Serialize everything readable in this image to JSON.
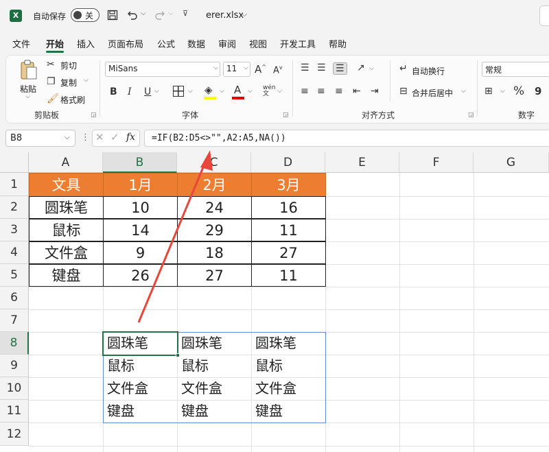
{
  "titlebar": {
    "autosave_label": "自动保存",
    "autosave_state": "关",
    "filename": "erer.xlsx",
    "chevron": "⌵"
  },
  "menu": [
    "文件",
    "开始",
    "插入",
    "页面布局",
    "公式",
    "数据",
    "审阅",
    "视图",
    "开发工具",
    "帮助"
  ],
  "ribbon": {
    "paste": "粘贴",
    "cut": "剪切",
    "copy": "复制",
    "format_painter": "格式刷",
    "clipboard_group": "剪贴板",
    "font_name": "MiSans",
    "font_size": "11",
    "bold": "B",
    "italic": "I",
    "underline": "U",
    "font_group": "字体",
    "wrap_text": "自动换行",
    "merge_center": "合并后居中",
    "alignment_group": "对齐方式",
    "number_format": "常规",
    "number_group": "数字",
    "percent": "%",
    "comma": "9"
  },
  "formula_bar": {
    "name_box": "B8",
    "formula": "=IF(B2:D5<>\"\",A2:A5,NA())",
    "fx": "fx"
  },
  "columns": [
    "A",
    "B",
    "C",
    "D",
    "E",
    "F",
    "G"
  ],
  "rows": [
    "1",
    "2",
    "3",
    "4",
    "5",
    "6",
    "7",
    "8",
    "9",
    "10",
    "11",
    "12"
  ],
  "table": {
    "header": [
      "文具",
      "1月",
      "2月",
      "3月"
    ],
    "rows": [
      [
        "圆珠笔",
        "10",
        "24",
        "16"
      ],
      [
        "鼠标",
        "14",
        "29",
        "11"
      ],
      [
        "文件盒",
        "9",
        "18",
        "27"
      ],
      [
        "键盘",
        "26",
        "27",
        "11"
      ]
    ]
  },
  "result": [
    [
      "圆珠笔",
      "圆珠笔",
      "圆珠笔"
    ],
    [
      "鼠标",
      "鼠标",
      "鼠标"
    ],
    [
      "文件盒",
      "文件盒",
      "文件盒"
    ],
    [
      "键盘",
      "键盘",
      "键盘"
    ]
  ],
  "colors": {
    "accent": "#217346",
    "header_fill": "#ed7d31",
    "arrow": "#e8463a"
  }
}
